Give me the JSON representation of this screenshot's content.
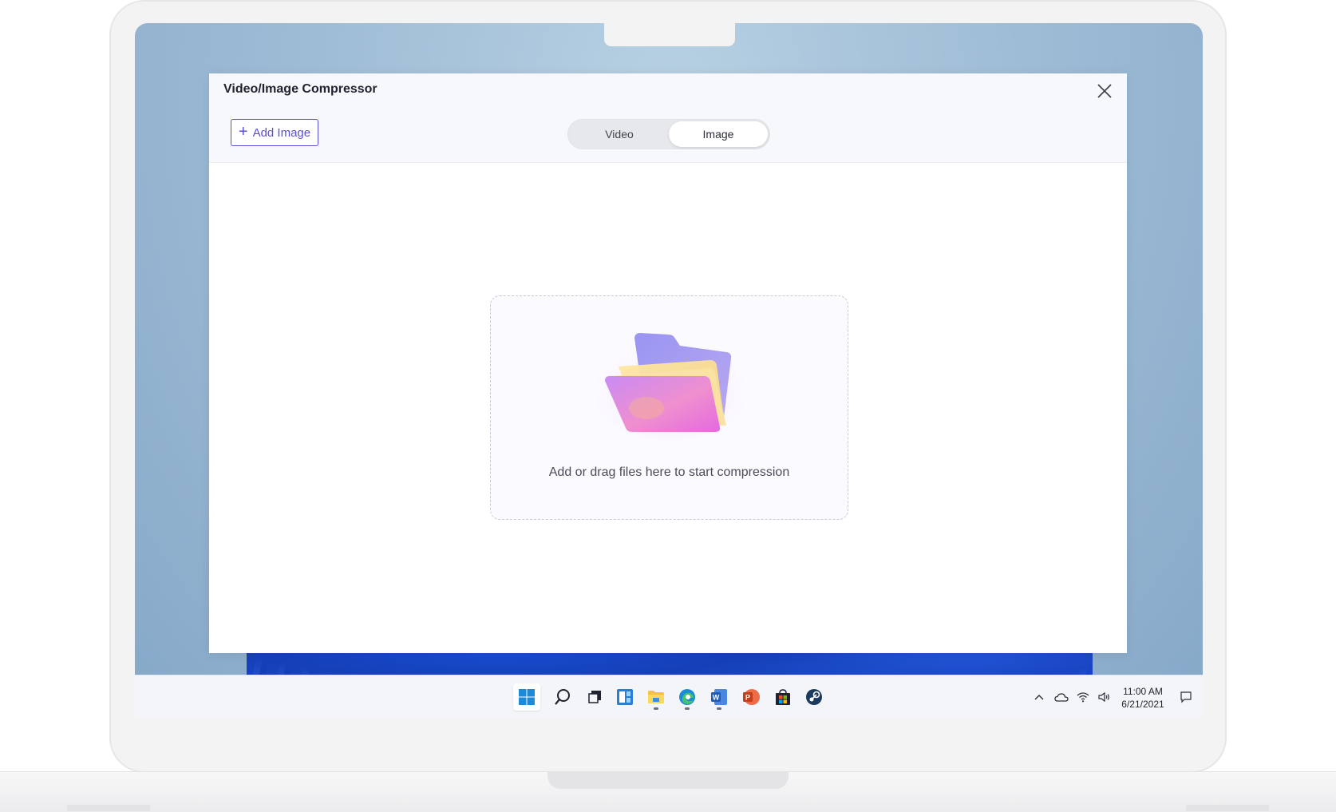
{
  "window": {
    "title": "Video/Image Compressor"
  },
  "toolbar": {
    "add_label": "Add Image"
  },
  "tabs": [
    {
      "label": "Video",
      "selected": false
    },
    {
      "label": "Image",
      "selected": true
    }
  ],
  "dropzone": {
    "text": "Add or drag files here to start compression"
  },
  "taskbar": {
    "icons": [
      "windows-start-icon",
      "search-icon",
      "task-view-icon",
      "widgets-icon",
      "file-explorer-icon",
      "edge-icon",
      "word-icon",
      "powerpoint-icon",
      "store-icon",
      "steam-icon"
    ],
    "clock": {
      "time": "11:00 AM",
      "date": "6/21/2021"
    }
  },
  "colors": {
    "accent": "#5b4fd6",
    "window_bg": "#ffffff",
    "header_bg": "#f7f8fb"
  }
}
